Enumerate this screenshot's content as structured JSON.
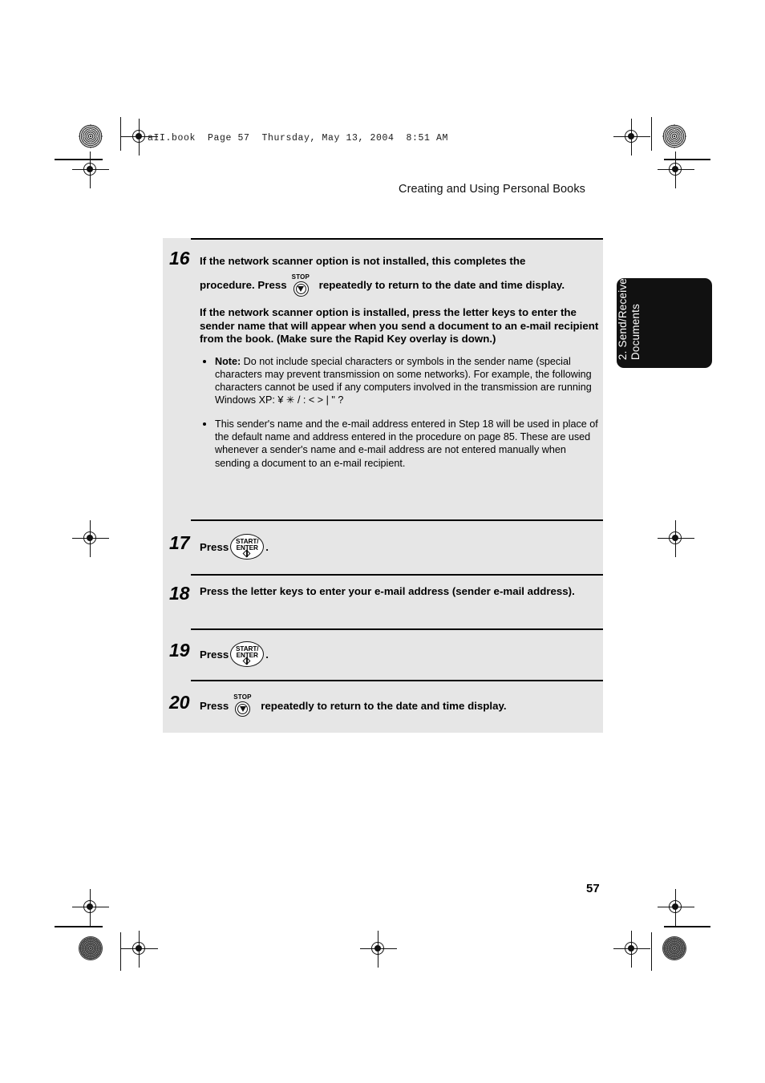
{
  "document": {
    "file_info": "aII.book  Page 57  Thursday, May 13, 2004  8:51 AM",
    "running_head": "Creating and Using Personal Books",
    "folio": "57",
    "side_tab": "2. Send/Receive\nDocuments"
  },
  "steps": [
    {
      "number": "16",
      "lead_a": "If the network scanner option is not installed, this completes the",
      "lead_b_pre": "procedure. Press",
      "lead_b_key": "stop-key",
      "lead_b_post": "repeatedly to return to the date and time display.",
      "para_bold": "If the network scanner option is installed, press the letter keys to enter the sender name that will appear when you send a document to an e-mail recipient from the book.  (Make sure the Rapid Key overlay is down.)",
      "bullets": [
        {
          "label": "Note:",
          "text": " Do not include special characters or symbols in the sender name (special characters may prevent transmission on some networks). For example, the following characters cannot be used if any computers involved in the transmission are running Windows XP:  ¥ ✳ / : < > | \" ?"
        },
        {
          "label": "",
          "text": "This sender's name and the e-mail address entered in Step 18 will be used in place of the default name and address entered in the procedure on page 85. These are used whenever a sender's name and e-mail address are not entered manually when sending a document to an e-mail recipient."
        }
      ]
    },
    {
      "number": "17",
      "press_pre": "Press",
      "press_key": "start-enter-key",
      "press_post": "."
    },
    {
      "number": "18",
      "text": "Press the letter keys to enter your e-mail address (sender e-mail address)."
    },
    {
      "number": "19",
      "press_pre": "Press",
      "press_key": "start-enter-key",
      "press_post": "."
    },
    {
      "number": "20",
      "press_pre": "Press",
      "press_key": "stop-key",
      "press_post": "repeatedly to return to the date and time display."
    }
  ],
  "keys": {
    "stop": {
      "caption": "STOP"
    },
    "start_enter": {
      "line1": "START/",
      "line2": "ENTER"
    }
  },
  "colors": {
    "panel_bg": "#e6e6e6",
    "tab_bg": "#111111",
    "rule": "#000000"
  }
}
